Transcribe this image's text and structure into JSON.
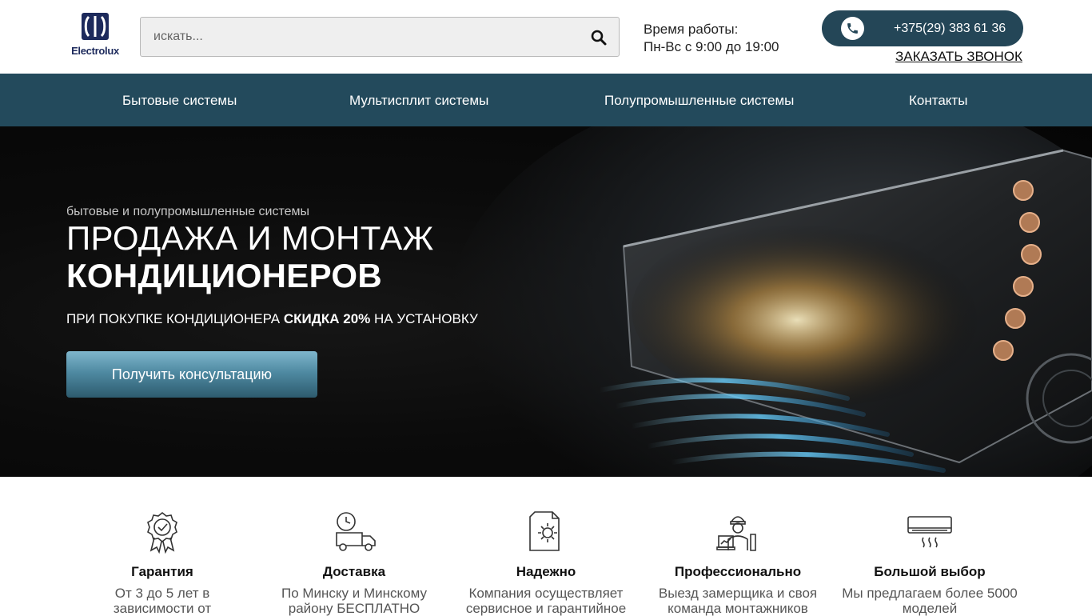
{
  "header": {
    "logo_text": "Electrolux",
    "search_placeholder": "искать...",
    "hours_label": "Время работы:",
    "hours_value": "Пн-Вс с 9:00 до 19:00",
    "phone": "+375(29) 383 61 36",
    "callback_label": "ЗАКАЗАТЬ ЗВОНОК"
  },
  "nav": {
    "items": [
      {
        "label": "Бытовые системы"
      },
      {
        "label": "Мультисплит системы"
      },
      {
        "label": "Полупромышленные системы"
      },
      {
        "label": "Контакты"
      }
    ]
  },
  "hero": {
    "subtitle": "бытовые и полупромышленные системы",
    "title_line1": "ПРОДАЖА И МОНТАЖ",
    "title_line2": "КОНДИЦИОНЕРОВ",
    "promo_prefix": "ПРИ ПОКУПКЕ КОНДИЦИОНЕРА",
    "promo_bold": "СКИДКА 20%",
    "promo_suffix": "НА УСТАНОВКУ",
    "cta_label": "Получить консультацию"
  },
  "features": [
    {
      "icon": "award-badge-icon",
      "title": "Гарантия",
      "desc": "От 3 до 5 лет в зависимости от"
    },
    {
      "icon": "delivery-truck-icon",
      "title": "Доставка",
      "desc": "По Минску и Минскому району БЕСПЛАТНО"
    },
    {
      "icon": "document-gear-icon",
      "title": "Надежно",
      "desc": "Компания осуществляет сервисное и гарантийное"
    },
    {
      "icon": "installer-worker-icon",
      "title": "Профессионально",
      "desc": "Выезд замерщика и своя команда монтажников"
    },
    {
      "icon": "air-conditioner-icon",
      "title": "Большой выбор",
      "desc": "Мы предлагаем более 5000 моделей"
    }
  ],
  "colors": {
    "nav_bg": "#234a5c",
    "phone_pill": "#244657",
    "cta_top": "#7fb6cc",
    "cta_bottom": "#2d5b6e",
    "brand": "#1d2a5c"
  }
}
